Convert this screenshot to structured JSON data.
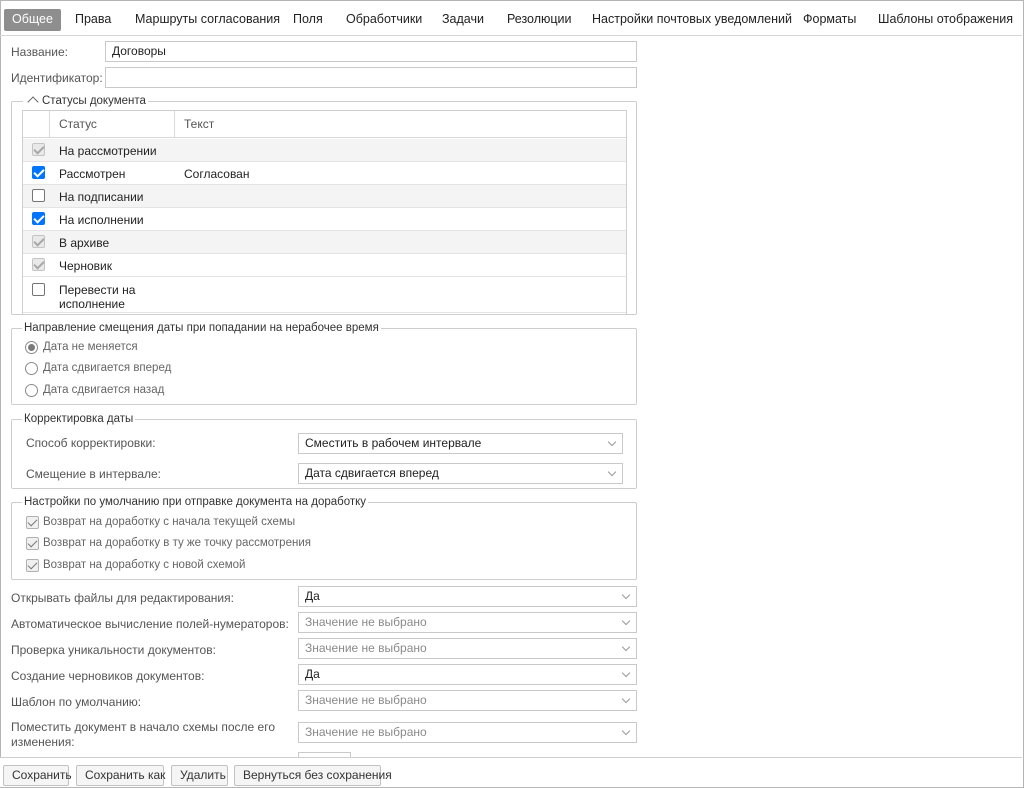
{
  "tabs": [
    {
      "label": "Общее",
      "active": true
    },
    {
      "label": "Права"
    },
    {
      "label": "Маршруты согласования"
    },
    {
      "label": "Поля"
    },
    {
      "label": "Обработчики"
    },
    {
      "label": "Задачи"
    },
    {
      "label": "Резолюции"
    },
    {
      "label": "Настройки почтовых уведомлений"
    },
    {
      "label": "Форматы"
    },
    {
      "label": "Шаблоны отображения"
    }
  ],
  "general": {
    "name_label": "Название:",
    "name_value": "Договоры",
    "id_label": "Идентификатор:",
    "id_value": ""
  },
  "statuses": {
    "legend": "Статусы документа",
    "col_status": "Статус",
    "col_text": "Текст",
    "rows": [
      {
        "label": "На рассмотрении",
        "text": "",
        "checked": true,
        "disabled": true
      },
      {
        "label": "Рассмотрен",
        "text": "Согласован",
        "checked": true,
        "disabled": false
      },
      {
        "label": "На подписании",
        "text": "",
        "checked": false,
        "disabled": false
      },
      {
        "label": "На исполнении",
        "text": "",
        "checked": true,
        "disabled": false
      },
      {
        "label": "В архиве",
        "text": "",
        "checked": true,
        "disabled": true
      },
      {
        "label": "Черновик",
        "text": "",
        "checked": true,
        "disabled": true
      },
      {
        "label": "Перевести на исполнение",
        "label_line1": "Перевести на",
        "label_line2": "исполнение",
        "text": "",
        "checked": false,
        "disabled": false
      }
    ]
  },
  "date_shift": {
    "legend": "Направление смещения даты при попадании на нерабочее время",
    "options": [
      "Дата не меняется",
      "Дата сдвигается вперед",
      "Дата сдвигается назад"
    ],
    "selected_index": 0
  },
  "date_correction": {
    "legend": "Корректировка даты",
    "method_label": "Способ корректировки:",
    "method_value": "Сместить в рабочем интервале",
    "offset_label": "Смещение в интервале:",
    "offset_value": "Дата сдвигается вперед"
  },
  "rework": {
    "legend": "Настройки по умолчанию при отправке документа на доработку",
    "options": [
      {
        "label": "Возврат на доработку с начала текущей схемы",
        "checked": true
      },
      {
        "label": "Возврат на доработку в ту же точку рассмотрения",
        "checked": true
      },
      {
        "label": "Возврат на доработку с новой схемой",
        "checked": true
      }
    ]
  },
  "settings": [
    {
      "label": "Открывать файлы для редактирования:",
      "value": "Да",
      "empty": false
    },
    {
      "label": "Автоматическое вычисление полей-нумераторов:",
      "value": "Значение не выбрано",
      "empty": true
    },
    {
      "label": "Проверка уникальности документов:",
      "value": "Значение не выбрано",
      "empty": true
    },
    {
      "label": "Создание черновиков документов:",
      "value": "Да",
      "empty": false
    },
    {
      "label": "Шаблон по умолчанию:",
      "value": "Значение не выбрано",
      "empty": true
    },
    {
      "label_line1": "Поместить документ в начало схемы после его",
      "label_line2": "изменения:",
      "value": "Значение не выбрано",
      "empty": true
    }
  ],
  "buttons": {
    "save": "Сохранить",
    "save_as": "Сохранить как",
    "delete": "Удалить",
    "back_without_save": "Вернуться без сохранения"
  }
}
